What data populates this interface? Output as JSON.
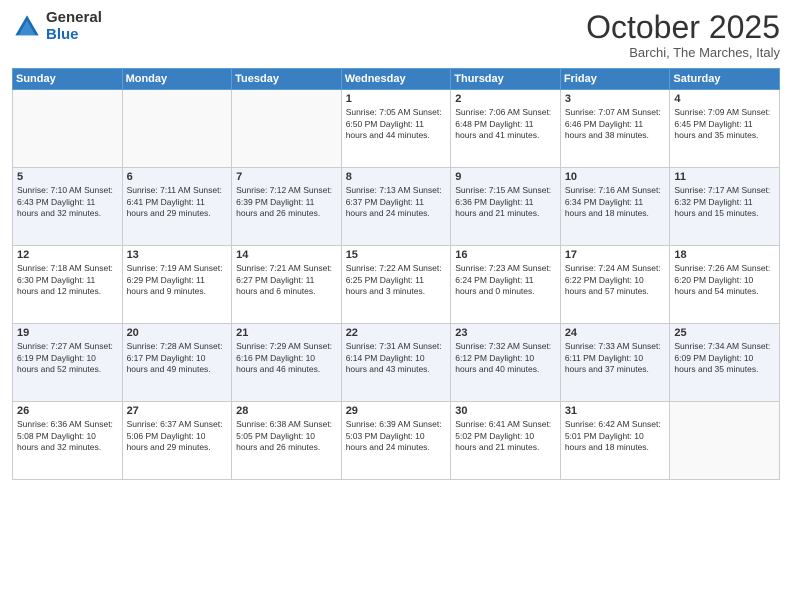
{
  "header": {
    "logo_general": "General",
    "logo_blue": "Blue",
    "month_title": "October 2025",
    "location": "Barchi, The Marches, Italy"
  },
  "weekdays": [
    "Sunday",
    "Monday",
    "Tuesday",
    "Wednesday",
    "Thursday",
    "Friday",
    "Saturday"
  ],
  "weeks": [
    [
      {
        "day": "",
        "info": ""
      },
      {
        "day": "",
        "info": ""
      },
      {
        "day": "",
        "info": ""
      },
      {
        "day": "1",
        "info": "Sunrise: 7:05 AM\nSunset: 6:50 PM\nDaylight: 11 hours and 44 minutes."
      },
      {
        "day": "2",
        "info": "Sunrise: 7:06 AM\nSunset: 6:48 PM\nDaylight: 11 hours and 41 minutes."
      },
      {
        "day": "3",
        "info": "Sunrise: 7:07 AM\nSunset: 6:46 PM\nDaylight: 11 hours and 38 minutes."
      },
      {
        "day": "4",
        "info": "Sunrise: 7:09 AM\nSunset: 6:45 PM\nDaylight: 11 hours and 35 minutes."
      }
    ],
    [
      {
        "day": "5",
        "info": "Sunrise: 7:10 AM\nSunset: 6:43 PM\nDaylight: 11 hours and 32 minutes."
      },
      {
        "day": "6",
        "info": "Sunrise: 7:11 AM\nSunset: 6:41 PM\nDaylight: 11 hours and 29 minutes."
      },
      {
        "day": "7",
        "info": "Sunrise: 7:12 AM\nSunset: 6:39 PM\nDaylight: 11 hours and 26 minutes."
      },
      {
        "day": "8",
        "info": "Sunrise: 7:13 AM\nSunset: 6:37 PM\nDaylight: 11 hours and 24 minutes."
      },
      {
        "day": "9",
        "info": "Sunrise: 7:15 AM\nSunset: 6:36 PM\nDaylight: 11 hours and 21 minutes."
      },
      {
        "day": "10",
        "info": "Sunrise: 7:16 AM\nSunset: 6:34 PM\nDaylight: 11 hours and 18 minutes."
      },
      {
        "day": "11",
        "info": "Sunrise: 7:17 AM\nSunset: 6:32 PM\nDaylight: 11 hours and 15 minutes."
      }
    ],
    [
      {
        "day": "12",
        "info": "Sunrise: 7:18 AM\nSunset: 6:30 PM\nDaylight: 11 hours and 12 minutes."
      },
      {
        "day": "13",
        "info": "Sunrise: 7:19 AM\nSunset: 6:29 PM\nDaylight: 11 hours and 9 minutes."
      },
      {
        "day": "14",
        "info": "Sunrise: 7:21 AM\nSunset: 6:27 PM\nDaylight: 11 hours and 6 minutes."
      },
      {
        "day": "15",
        "info": "Sunrise: 7:22 AM\nSunset: 6:25 PM\nDaylight: 11 hours and 3 minutes."
      },
      {
        "day": "16",
        "info": "Sunrise: 7:23 AM\nSunset: 6:24 PM\nDaylight: 11 hours and 0 minutes."
      },
      {
        "day": "17",
        "info": "Sunrise: 7:24 AM\nSunset: 6:22 PM\nDaylight: 10 hours and 57 minutes."
      },
      {
        "day": "18",
        "info": "Sunrise: 7:26 AM\nSunset: 6:20 PM\nDaylight: 10 hours and 54 minutes."
      }
    ],
    [
      {
        "day": "19",
        "info": "Sunrise: 7:27 AM\nSunset: 6:19 PM\nDaylight: 10 hours and 52 minutes."
      },
      {
        "day": "20",
        "info": "Sunrise: 7:28 AM\nSunset: 6:17 PM\nDaylight: 10 hours and 49 minutes."
      },
      {
        "day": "21",
        "info": "Sunrise: 7:29 AM\nSunset: 6:16 PM\nDaylight: 10 hours and 46 minutes."
      },
      {
        "day": "22",
        "info": "Sunrise: 7:31 AM\nSunset: 6:14 PM\nDaylight: 10 hours and 43 minutes."
      },
      {
        "day": "23",
        "info": "Sunrise: 7:32 AM\nSunset: 6:12 PM\nDaylight: 10 hours and 40 minutes."
      },
      {
        "day": "24",
        "info": "Sunrise: 7:33 AM\nSunset: 6:11 PM\nDaylight: 10 hours and 37 minutes."
      },
      {
        "day": "25",
        "info": "Sunrise: 7:34 AM\nSunset: 6:09 PM\nDaylight: 10 hours and 35 minutes."
      }
    ],
    [
      {
        "day": "26",
        "info": "Sunrise: 6:36 AM\nSunset: 5:08 PM\nDaylight: 10 hours and 32 minutes."
      },
      {
        "day": "27",
        "info": "Sunrise: 6:37 AM\nSunset: 5:06 PM\nDaylight: 10 hours and 29 minutes."
      },
      {
        "day": "28",
        "info": "Sunrise: 6:38 AM\nSunset: 5:05 PM\nDaylight: 10 hours and 26 minutes."
      },
      {
        "day": "29",
        "info": "Sunrise: 6:39 AM\nSunset: 5:03 PM\nDaylight: 10 hours and 24 minutes."
      },
      {
        "day": "30",
        "info": "Sunrise: 6:41 AM\nSunset: 5:02 PM\nDaylight: 10 hours and 21 minutes."
      },
      {
        "day": "31",
        "info": "Sunrise: 6:42 AM\nSunset: 5:01 PM\nDaylight: 10 hours and 18 minutes."
      },
      {
        "day": "",
        "info": ""
      }
    ]
  ]
}
